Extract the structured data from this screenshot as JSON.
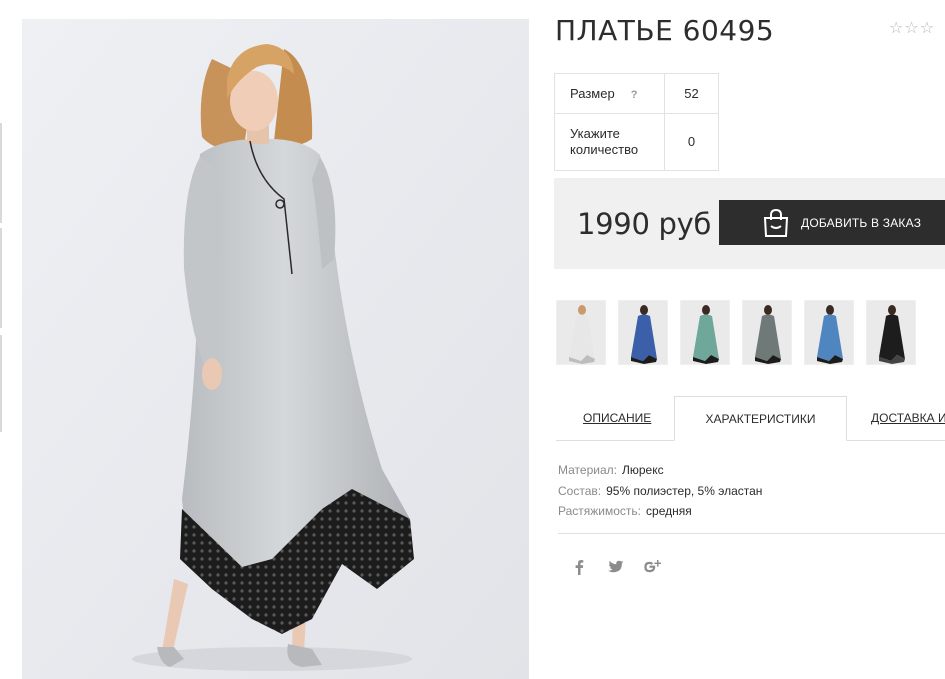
{
  "product": {
    "title": "ПЛАТЬЕ 60495",
    "rating_stars": 0,
    "rating_max": 3
  },
  "options": {
    "size_label": "Размер",
    "size_help": "?",
    "size_value": "52",
    "qty_label": "Укажите количество",
    "qty_value": "0"
  },
  "purchase": {
    "price": "1990 руб",
    "order_button": "ДОБАВИТЬ В ЗАКАЗ",
    "order_icon": "shopping-bag-icon"
  },
  "thumbnails": [
    {
      "name": "thumb-white",
      "dress_color": "#e7e7e7"
    },
    {
      "name": "thumb-blue-pattern",
      "dress_color": "#3b5fa8"
    },
    {
      "name": "thumb-mint",
      "dress_color": "#6fa89a"
    },
    {
      "name": "thumb-grey",
      "dress_color": "#6f7a78"
    },
    {
      "name": "thumb-denim",
      "dress_color": "#4f86c0"
    },
    {
      "name": "thumb-black",
      "dress_color": "#1d1d1d"
    }
  ],
  "tabs": [
    {
      "label": "ОПИСАНИЕ",
      "active": false
    },
    {
      "label": "ХАРАКТЕРИСТИКИ",
      "active": true
    },
    {
      "label": "ДОСТАВКА И",
      "active": false
    }
  ],
  "specs": [
    {
      "key": "Материал:",
      "value": "Люрекс"
    },
    {
      "key": "Состав:",
      "value": "95% полиэстер, 5% эластан"
    },
    {
      "key": "Растяжимость:",
      "value": "средняя"
    }
  ],
  "social": [
    {
      "icon": "facebook-icon",
      "glyph": "f"
    },
    {
      "icon": "twitter-icon",
      "glyph": "t"
    },
    {
      "icon": "google-plus-icon",
      "glyph": "g+"
    }
  ],
  "colors": {
    "button_bg": "#2d2d2d",
    "price_bar_bg": "#f0f0f0",
    "dress": "#c4c8cb",
    "lace": "#1a1a1a",
    "photo_bg": "#e8e9ee"
  }
}
